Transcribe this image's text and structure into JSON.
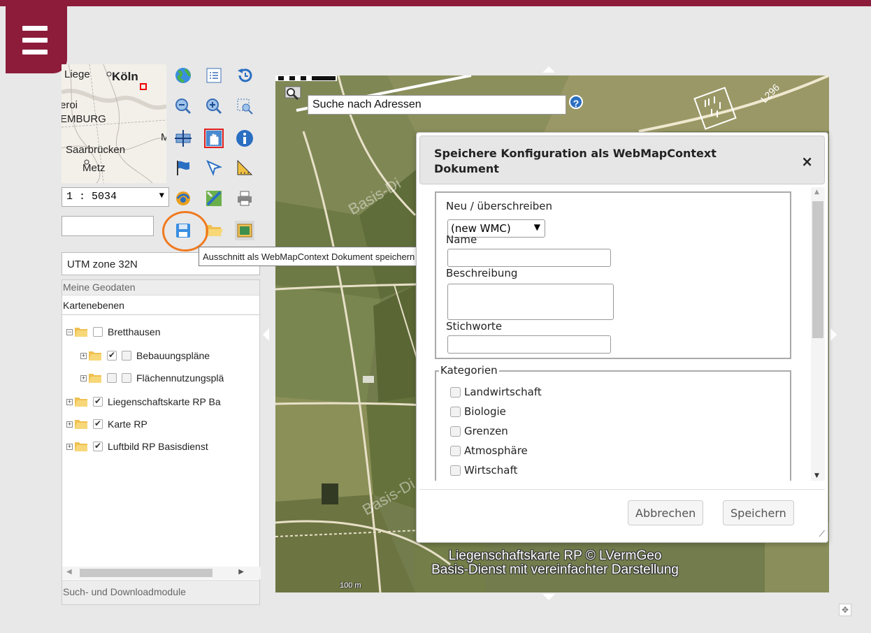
{
  "menu": {
    "icon": "hamburger-menu-icon"
  },
  "overview_map": {
    "labels": [
      "Liege",
      "Köln",
      "eroi",
      "EMBURG",
      "Saarbrücken",
      "Metz",
      "M"
    ]
  },
  "toolbar": {
    "scale_value": "1 : 5034",
    "tooltip": "Ausschnitt als WebMapContext Dokument speichern",
    "icons": [
      "globe-icon",
      "legend-list-icon",
      "history-back-icon",
      "zoom-out-icon",
      "zoom-in-icon",
      "zoom-extent-icon",
      "pan-icon",
      "select-hand-icon",
      "info-icon",
      "flag-icon",
      "pointer-measure-icon",
      "ruler-icon",
      "coordinates-icon",
      "map-edit-icon",
      "print-icon",
      "save-wmc-icon",
      "open-folder-icon",
      "image-icon"
    ]
  },
  "projection": {
    "value": "UTM zone 32N"
  },
  "layer_panel": {
    "header": "Meine Geodaten",
    "subheader": "Kartenebenen",
    "footer": "Such- und Downloadmodule",
    "layers": [
      {
        "label": "Bretthausen",
        "checked": false
      },
      {
        "label": "Bebauungspläne",
        "checked": true
      },
      {
        "label": "Flächennutzungsplä",
        "checked": false
      },
      {
        "label": "Liegenschaftskarte RP Ba",
        "checked": true
      },
      {
        "label": "Karte RP",
        "checked": true
      },
      {
        "label": "Luftbild RP Basisdienst",
        "checked": true
      }
    ]
  },
  "map": {
    "search_value": "Suche nach Adressen",
    "help": "?",
    "road_label": "L296",
    "watermark": "Basis-Di",
    "attribution_line1": "Liegenschaftskarte RP © LVermGeo",
    "attribution_line2": "Basis-Dienst mit vereinfachter Darstellung",
    "scalebar_label": "100 m"
  },
  "dialog": {
    "title": "Speichere Konfiguration als WebMapContext Dokument",
    "close": "×",
    "new_overwrite_label": "Neu / überschreiben",
    "new_overwrite_value": "(new WMC)",
    "name_label": "Name",
    "description_label": "Beschreibung",
    "keywords_label": "Stichworte",
    "categories_legend": "Kategorien",
    "categories": [
      "Landwirtschaft",
      "Biologie",
      "Grenzen",
      "Atmosphäre",
      "Wirtschaft"
    ],
    "cancel_label": "Abbrechen",
    "save_label": "Speichern"
  }
}
